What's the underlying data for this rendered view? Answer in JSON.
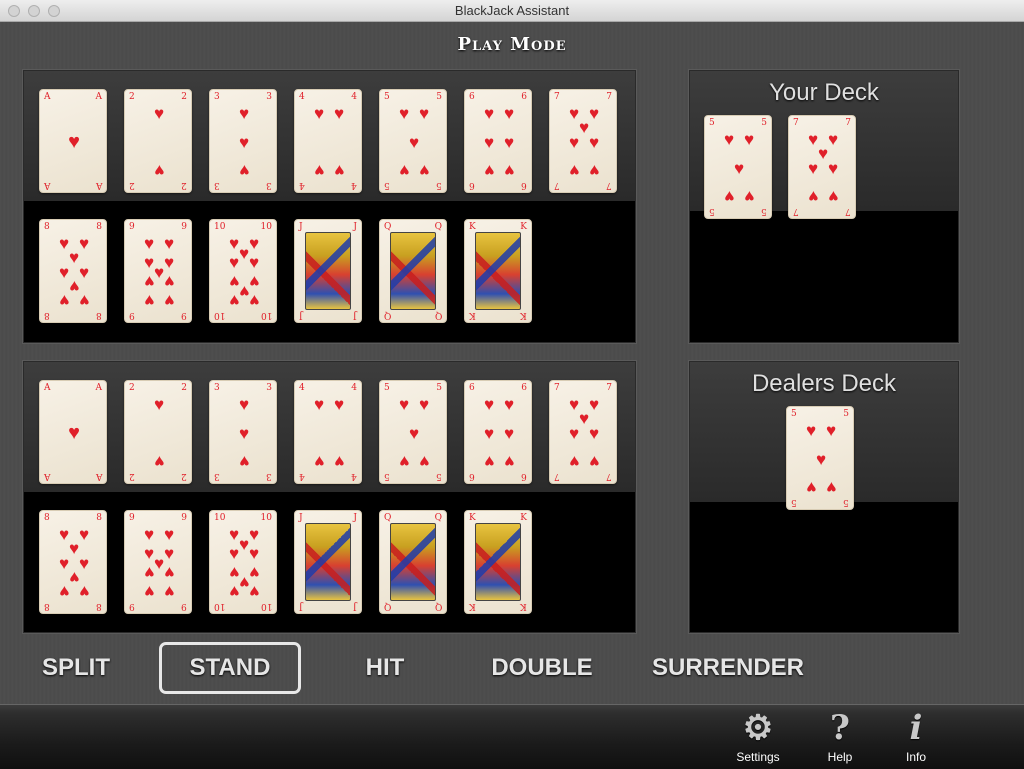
{
  "window": {
    "title": "BlackJack Assistant"
  },
  "header": {
    "mode_title": "Play Mode"
  },
  "player_selector": {
    "cards": [
      {
        "rank": "A",
        "suit": "hearts"
      },
      {
        "rank": "2",
        "suit": "hearts"
      },
      {
        "rank": "3",
        "suit": "hearts"
      },
      {
        "rank": "4",
        "suit": "hearts"
      },
      {
        "rank": "5",
        "suit": "hearts"
      },
      {
        "rank": "6",
        "suit": "hearts"
      },
      {
        "rank": "7",
        "suit": "hearts"
      },
      {
        "rank": "8",
        "suit": "hearts"
      },
      {
        "rank": "9",
        "suit": "hearts"
      },
      {
        "rank": "10",
        "suit": "hearts"
      },
      {
        "rank": "J",
        "suit": "hearts"
      },
      {
        "rank": "Q",
        "suit": "hearts"
      },
      {
        "rank": "K",
        "suit": "hearts"
      }
    ]
  },
  "dealer_selector": {
    "cards": [
      {
        "rank": "A",
        "suit": "hearts"
      },
      {
        "rank": "2",
        "suit": "hearts"
      },
      {
        "rank": "3",
        "suit": "hearts"
      },
      {
        "rank": "4",
        "suit": "hearts"
      },
      {
        "rank": "5",
        "suit": "hearts"
      },
      {
        "rank": "6",
        "suit": "hearts"
      },
      {
        "rank": "7",
        "suit": "hearts"
      },
      {
        "rank": "8",
        "suit": "hearts"
      },
      {
        "rank": "9",
        "suit": "hearts"
      },
      {
        "rank": "10",
        "suit": "hearts"
      },
      {
        "rank": "J",
        "suit": "hearts"
      },
      {
        "rank": "Q",
        "suit": "hearts"
      },
      {
        "rank": "K",
        "suit": "hearts"
      }
    ]
  },
  "your_deck": {
    "title": "Your Deck",
    "cards": [
      {
        "rank": "5",
        "suit": "hearts"
      },
      {
        "rank": "7",
        "suit": "hearts"
      }
    ]
  },
  "dealers_deck": {
    "title": "Dealers Deck",
    "cards": [
      {
        "rank": "5",
        "suit": "hearts"
      }
    ]
  },
  "actions": {
    "split": "SPLIT",
    "stand": "STAND",
    "hit": "HIT",
    "double": "DOUBLE",
    "surrender": "SURRENDER",
    "selected": "stand"
  },
  "toolbar": {
    "settings_label": "Settings",
    "help_label": "Help",
    "info_label": "Info",
    "settings_icon": "gear-icon",
    "help_icon": "question-icon",
    "info_icon": "info-icon"
  },
  "colors": {
    "suit_red": "#e0202a",
    "panel_bg": "#000000",
    "text_light": "#e6e6e6"
  }
}
